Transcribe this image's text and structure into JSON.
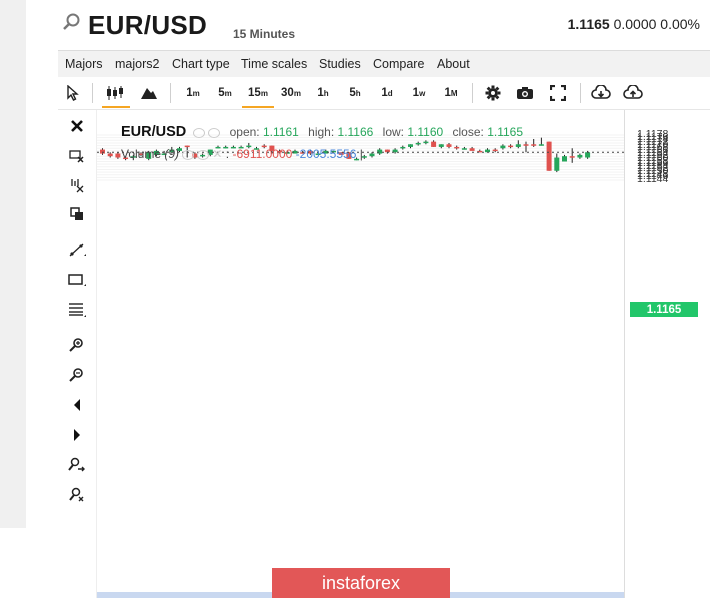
{
  "header": {
    "symbol": "EUR/USD",
    "timeframe": "15 Minutes",
    "price": "1.1165",
    "change": "0.0000",
    "change_pct": "0.00%"
  },
  "menu": [
    "Majors",
    "majors2",
    "Chart type",
    "Time scales",
    "Studies",
    "Compare",
    "About"
  ],
  "toolbar": {
    "intervals": [
      "1m",
      "5m",
      "15m",
      "30m",
      "1h",
      "5h",
      "1d",
      "1w",
      "1M"
    ],
    "active_interval": "15m",
    "icons": [
      "cursor-icon",
      "candles-icon",
      "area-chart-icon",
      "gear-icon",
      "camera-icon",
      "fullscreen-icon",
      "download-icon",
      "upload-icon"
    ]
  },
  "side_tools": [
    "close-icon",
    "eraser-icon",
    "magnet-icon",
    "copy-icon",
    "trendline-icon",
    "rectangle-icon",
    "fibonacci-icon",
    "zoom-in-icon",
    "zoom-out-icon",
    "arrow-left-icon",
    "arrow-right-icon",
    "zoom-forward-icon",
    "zoom-reset-icon"
  ],
  "legend": {
    "symbol": "EUR/USD",
    "open_label": "open:",
    "open": "1.1161",
    "high_label": "high:",
    "high": "1.1166",
    "low_label": "low:",
    "low": "1.1160",
    "close_label": "close:",
    "close": "1.1165",
    "volume_label": "Volume",
    "volume_period": "(9)",
    "volume_val1": "-6911.0000",
    "volume_val2": "-2005.5556"
  },
  "current_price_tag": "1.1165",
  "watermark": "instaforex",
  "colors": {
    "up": "#26a65b",
    "down": "#e0524f",
    "accent": "#f5a623",
    "price_tag": "#22c66a"
  },
  "chart_data": {
    "type": "candlestick",
    "ylim": [
      1.1143,
      1.118
    ],
    "yticks": [
      "1.1178",
      "1.1176",
      "1.1174",
      "1.1172",
      "1.1170",
      "1.1168",
      "1.1166",
      "1.1164",
      "1.1162",
      "1.1160",
      "1.1158",
      "1.1156",
      "1.1154",
      "1.1152",
      "1.1150",
      "1.1148",
      "1.1146",
      "1.1144"
    ],
    "candles": [
      [
        1.1167,
        1.1168,
        1.1163,
        1.1164
      ],
      [
        1.1164,
        1.1165,
        1.1161,
        1.1162
      ],
      [
        1.1164,
        1.1165,
        1.116,
        1.1161
      ],
      [
        1.1161,
        1.1162,
        1.1159,
        1.116
      ],
      [
        1.1161,
        1.1163,
        1.1159,
        1.1162
      ],
      [
        1.1164,
        1.1165,
        1.1162,
        1.1163
      ],
      [
        1.116,
        1.1166,
        1.1159,
        1.1165
      ],
      [
        1.1163,
        1.1167,
        1.1162,
        1.1166
      ],
      [
        1.1163,
        1.1166,
        1.1163,
        1.1164
      ],
      [
        1.1165,
        1.1169,
        1.1164,
        1.1167
      ],
      [
        1.1166,
        1.1169,
        1.1165,
        1.1168
      ],
      [
        1.117,
        1.117,
        1.1161,
        1.1169
      ],
      [
        1.1164,
        1.1165,
        1.116,
        1.1161
      ],
      [
        1.1162,
        1.1164,
        1.1161,
        1.1163
      ],
      [
        1.1163,
        1.1167,
        1.1162,
        1.1167
      ],
      [
        1.1169,
        1.117,
        1.1168,
        1.1169
      ],
      [
        1.1169,
        1.117,
        1.1168,
        1.1169
      ],
      [
        1.1169,
        1.117,
        1.1168,
        1.1169
      ],
      [
        1.1169,
        1.117,
        1.1169,
        1.1169
      ],
      [
        1.1169,
        1.1172,
        1.1168,
        1.117
      ],
      [
        1.1168,
        1.1169,
        1.1167,
        1.1168
      ],
      [
        1.117,
        1.1171,
        1.1168,
        1.1169
      ],
      [
        1.117,
        1.117,
        1.1164,
        1.1166
      ],
      [
        1.1166,
        1.1167,
        1.1164,
        1.1165
      ],
      [
        1.1165,
        1.1166,
        1.1164,
        1.1165
      ],
      [
        1.1164,
        1.1167,
        1.1164,
        1.1166
      ],
      [
        1.1165,
        1.1166,
        1.1164,
        1.1164
      ],
      [
        1.1166,
        1.1167,
        1.1163,
        1.1164
      ],
      [
        1.1164,
        1.1166,
        1.1163,
        1.1164
      ],
      [
        1.1164,
        1.1167,
        1.1164,
        1.1166
      ],
      [
        1.1165,
        1.1166,
        1.1165,
        1.1166
      ],
      [
        1.1165,
        1.1165,
        1.1163,
        1.1163
      ],
      [
        1.1165,
        1.1165,
        1.116,
        1.116
      ],
      [
        1.116,
        1.1161,
        1.1159,
        1.116
      ],
      [
        1.1161,
        1.1163,
        1.116,
        1.1162
      ],
      [
        1.1162,
        1.1165,
        1.1161,
        1.1164
      ],
      [
        1.1164,
        1.1168,
        1.1163,
        1.1167
      ],
      [
        1.1167,
        1.1167,
        1.1164,
        1.1165
      ],
      [
        1.1165,
        1.1168,
        1.1164,
        1.1167
      ],
      [
        1.1168,
        1.117,
        1.1167,
        1.1169
      ],
      [
        1.1169,
        1.1171,
        1.1168,
        1.1171
      ],
      [
        1.1172,
        1.1173,
        1.117,
        1.1172
      ],
      [
        1.1172,
        1.1174,
        1.1171,
        1.1173
      ],
      [
        1.1173,
        1.1174,
        1.1169,
        1.1169
      ],
      [
        1.1169,
        1.1171,
        1.1168,
        1.1171
      ],
      [
        1.1171,
        1.1172,
        1.1168,
        1.1169
      ],
      [
        1.1169,
        1.117,
        1.1167,
        1.1168
      ],
      [
        1.1168,
        1.1169,
        1.1167,
        1.1168
      ],
      [
        1.1168,
        1.1169,
        1.1167,
        1.1166
      ],
      [
        1.1166,
        1.1167,
        1.1165,
        1.1165
      ],
      [
        1.1165,
        1.1168,
        1.1165,
        1.1167
      ],
      [
        1.1167,
        1.1168,
        1.1165,
        1.1166
      ],
      [
        1.1168,
        1.1171,
        1.1167,
        1.117
      ],
      [
        1.117,
        1.1171,
        1.1168,
        1.1169
      ],
      [
        1.1169,
        1.1174,
        1.1168,
        1.1171
      ],
      [
        1.1171,
        1.1173,
        1.1165,
        1.117
      ],
      [
        1.1171,
        1.1175,
        1.1169,
        1.117
      ],
      [
        1.1171,
        1.1176,
        1.117,
        1.1171
      ],
      [
        1.1173,
        1.1173,
        1.1151,
        1.1151
      ],
      [
        1.1151,
        1.1164,
        1.115,
        1.1161
      ],
      [
        1.1158,
        1.1163,
        1.1158,
        1.1162
      ],
      [
        1.1162,
        1.1168,
        1.1157,
        1.1161
      ],
      [
        1.1161,
        1.1164,
        1.116,
        1.1163
      ],
      [
        1.1161,
        1.1166,
        1.116,
        1.1165
      ]
    ]
  }
}
